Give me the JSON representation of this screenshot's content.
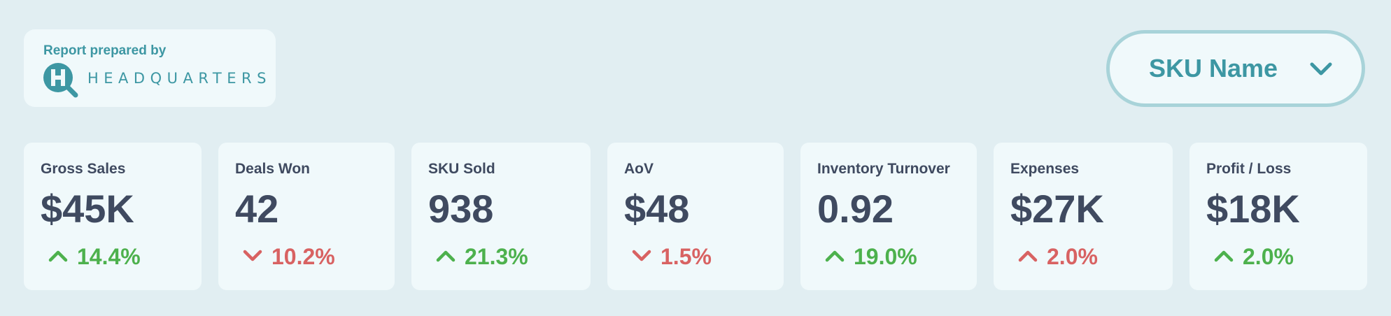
{
  "brand": {
    "caption": "Report prepared by",
    "name": "HEADQUARTERS",
    "logo_letter": "H",
    "color": "#3d97a3"
  },
  "filter": {
    "label": "SKU Name",
    "icon": "chevron-down-icon"
  },
  "colors": {
    "positive": "#4db14d",
    "negative": "#d86262",
    "text": "#3f4a60",
    "accent": "#3d97a3"
  },
  "kpis": [
    {
      "label": "Gross Sales",
      "value": "$45K",
      "delta": "14.4%",
      "direction": "up",
      "tone": "positive"
    },
    {
      "label": "Deals Won",
      "value": "42",
      "delta": "10.2%",
      "direction": "down",
      "tone": "negative"
    },
    {
      "label": "SKU Sold",
      "value": "938",
      "delta": "21.3%",
      "direction": "up",
      "tone": "positive"
    },
    {
      "label": "AoV",
      "value": "$48",
      "delta": "1.5%",
      "direction": "down",
      "tone": "negative"
    },
    {
      "label": "Inventory Turnover",
      "value": "0.92",
      "delta": "19.0%",
      "direction": "up",
      "tone": "positive"
    },
    {
      "label": "Expenses",
      "value": "$27K",
      "delta": "2.0%",
      "direction": "up",
      "tone": "negative"
    },
    {
      "label": "Profit / Loss",
      "value": "$18K",
      "delta": "2.0%",
      "direction": "up",
      "tone": "positive"
    }
  ]
}
